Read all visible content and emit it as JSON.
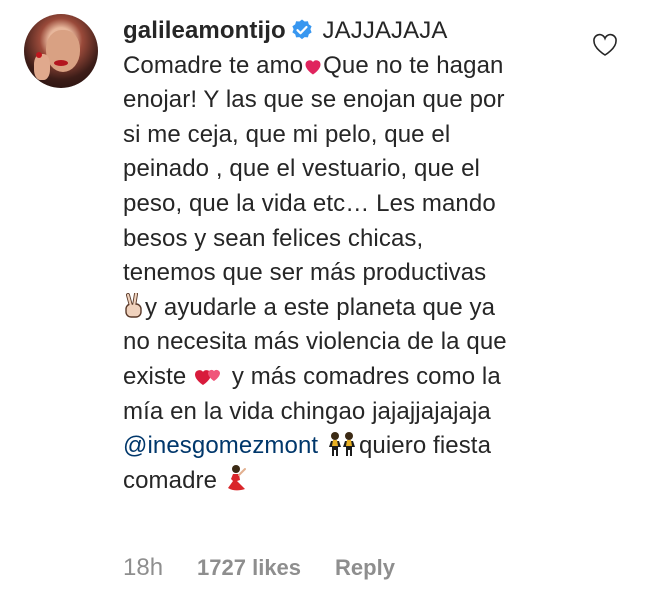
{
  "comment": {
    "username": "galileamontijo",
    "lines": [
      "JAJJAJAJA",
      "Comadre te amo",
      "Que no te hagan",
      "enojar! Y las que se enojan que por",
      "si me ceja, que mi pelo, que el",
      "peinado , que el vestuario, que el",
      "peso, que la vida etc… Les mando",
      "besos y sean felices chicas,",
      "tenemos que ser más productivas",
      "y ayudarle a este planeta que ya",
      "no necesita más violencia de la que",
      "existe",
      " y más comadres como la",
      "mía en la vida chingao jajajjajajaja",
      "@inesgomezmont",
      "quiero fiesta",
      "comadre"
    ]
  },
  "meta": {
    "time": "18h",
    "likes": "1727 likes",
    "reply": "Reply"
  },
  "icons": {
    "verified": "verified-badge-icon",
    "like": "heart-outline-icon",
    "emoji_heart": "red-heart-emoji",
    "emoji_two_hearts": "two-hearts-emoji",
    "emoji_victory": "victory-hand-emoji",
    "emoji_dancers": "women-dancing-emoji",
    "emoji_flamenco": "flamenco-dancer-emoji"
  },
  "colors": {
    "text": "#262626",
    "secondary": "#8e8e8e",
    "mention": "#00376b",
    "verified": "#3897f0",
    "heart": "#e0245e"
  }
}
